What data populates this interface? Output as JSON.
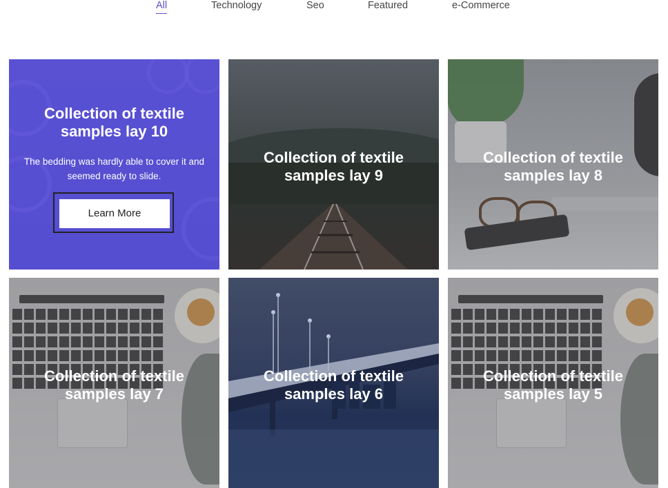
{
  "filters": [
    {
      "label": "All",
      "active": true
    },
    {
      "label": "Technology",
      "active": false
    },
    {
      "label": "Seo",
      "active": false
    },
    {
      "label": "Featured",
      "active": false
    },
    {
      "label": "e-Commerce",
      "active": false
    }
  ],
  "cards": [
    {
      "title": "Collection of textile samples lay 10",
      "description": "The bedding was hardly able to cover it and seemed ready to slide.",
      "button": "Learn More"
    },
    {
      "title": "Collection of textile samples lay 9"
    },
    {
      "title": "Collection of textile samples lay 8"
    },
    {
      "title": "Collection of textile samples lay 7"
    },
    {
      "title": "Collection of textile samples lay 6"
    },
    {
      "title": "Collection of textile samples lay 5"
    }
  ],
  "colors": {
    "accent": "#5a4fd0",
    "active_overlay": "#5046d6"
  }
}
